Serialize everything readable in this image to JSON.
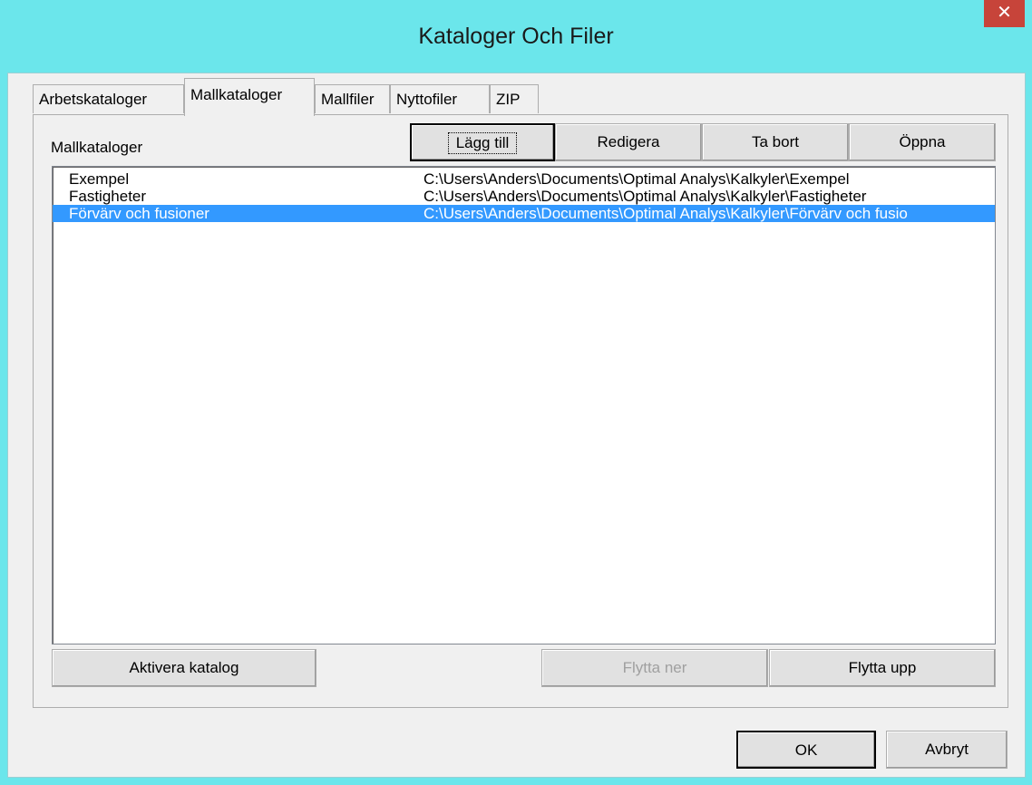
{
  "window": {
    "title": "Kataloger Och Filer",
    "close_glyph": "✕"
  },
  "tabs": [
    {
      "label": "Arbetskataloger",
      "active": false
    },
    {
      "label": "Mallkataloger",
      "active": true
    },
    {
      "label": "Mallfiler",
      "active": false
    },
    {
      "label": "Nyttofiler",
      "active": false
    },
    {
      "label": "ZIP",
      "active": false
    }
  ],
  "panel": {
    "section_label": "Mallkataloger",
    "buttons": {
      "add": "Lägg till",
      "edit": "Redigera",
      "remove": "Ta bort",
      "open": "Öppna"
    },
    "list": [
      {
        "name": "Exempel",
        "path": "C:\\Users\\Anders\\Documents\\Optimal Analys\\Kalkyler\\Exempel",
        "selected": false
      },
      {
        "name": "Fastigheter",
        "path": "C:\\Users\\Anders\\Documents\\Optimal Analys\\Kalkyler\\Fastigheter",
        "selected": false
      },
      {
        "name": "Förvärv och fusioner",
        "path": "C:\\Users\\Anders\\Documents\\Optimal Analys\\Kalkyler\\Förvärv och fusio",
        "selected": true
      }
    ],
    "bottom_buttons": {
      "activate": "Aktivera katalog",
      "move_down": "Flytta ner",
      "move_up": "Flytta upp"
    }
  },
  "footer": {
    "ok": "OK",
    "cancel": "Avbryt"
  },
  "colors": {
    "titlebar": "#6BE6EB",
    "close": "#C7443A",
    "selection": "#3399FF",
    "face": "#F0F0F0"
  }
}
